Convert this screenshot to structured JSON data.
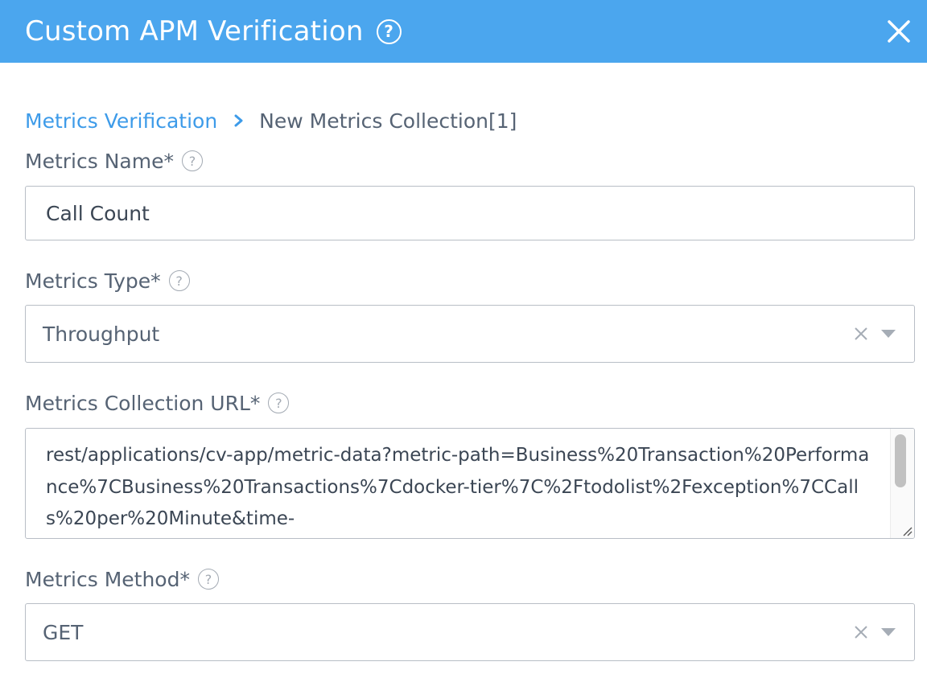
{
  "dialog": {
    "title": "Custom APM Verification",
    "help_icon": "question-circle-icon",
    "close_icon": "close-icon"
  },
  "breadcrumb": {
    "parent": "Metrics Verification",
    "separator_icon": "chevron-right-icon",
    "current": "New Metrics Collection[1]"
  },
  "fields": {
    "metrics_name": {
      "label": "Metrics Name*",
      "value": "Call Count"
    },
    "metrics_type": {
      "label": "Metrics Type*",
      "value": "Throughput"
    },
    "metrics_url": {
      "label": "Metrics Collection URL*",
      "value": "rest/applications/cv-app/metric-data?metric-path=Business%20Transaction%20Performance%7CBusiness%20Transactions%7Cdocker-tier%7C%2Ftodolist%2Fexception%7CCalls%20per%20Minute&time-"
    },
    "metrics_method": {
      "label": "Metrics Method*",
      "value": "GET"
    }
  },
  "help_glyph": "?",
  "colors": {
    "header_bg": "#4ba6ee",
    "link": "#3d9be9",
    "label": "#566374",
    "border": "#b8bec6"
  }
}
